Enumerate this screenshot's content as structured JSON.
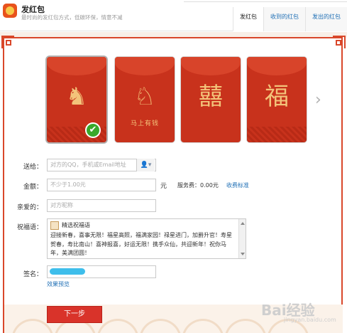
{
  "header": {
    "title": "发红包",
    "subtitle": "最时尚的发红包方式，低碳环保，情意不减",
    "tabs": [
      {
        "label": "发红包",
        "active": true
      },
      {
        "label": "收到的红包",
        "active": false
      },
      {
        "label": "发出的红包",
        "active": false
      }
    ]
  },
  "cards": [
    {
      "art": "♞",
      "caption": "",
      "selected": true
    },
    {
      "art": "♘",
      "caption": "马上有钱",
      "selected": false
    },
    {
      "art": "囍",
      "caption": "",
      "selected": false
    },
    {
      "art": "福",
      "caption": "",
      "selected": false
    }
  ],
  "next_arrow": "›",
  "check_mark": "✔",
  "form": {
    "recipient": {
      "label": "送给：",
      "placeholder": "对方的QQ，手机或Email地址"
    },
    "amount": {
      "label": "金额：",
      "placeholder": "不少于1.00元",
      "unit": "元",
      "fee_label": "服务费：",
      "fee_value": "0.00元",
      "fee_link": "收费标准"
    },
    "nickname": {
      "label": "亲爱的：",
      "placeholder": "对方昵称"
    },
    "blessing": {
      "label": "祝福语：",
      "pick_label": "精选祝福语",
      "text": "迎接新春，喜事无限！福星高照，福满家园！禄星进门，加爵升官！寿星贺春，寿比南山！喜神报喜，好运无限！携手众仙，共迎新年！祝你马年，美满团圆！"
    },
    "signature": {
      "label": "签名："
    },
    "preview_link": "效果预览",
    "submit_label": "下一步"
  },
  "watermark": {
    "text": "Bai经验",
    "sub": "jingyan.baidu.com"
  },
  "colors": {
    "accent_red": "#d9332a",
    "link_blue": "#1f6fb5",
    "card_red": "#c8321c",
    "gold": "#f3c37a"
  }
}
